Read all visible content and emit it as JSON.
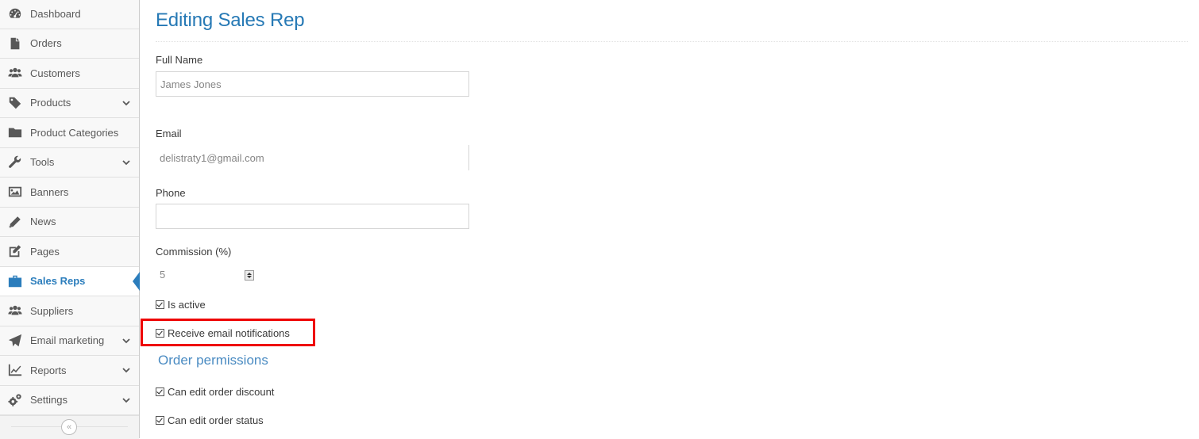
{
  "sidebar": {
    "items": [
      {
        "name": "dashboard",
        "label": "Dashboard",
        "icon": "dashboard-icon",
        "chevron": false,
        "active": false
      },
      {
        "name": "orders",
        "label": "Orders",
        "icon": "file-icon",
        "chevron": false,
        "active": false
      },
      {
        "name": "customers",
        "label": "Customers",
        "icon": "users-icon",
        "chevron": false,
        "active": false
      },
      {
        "name": "products",
        "label": "Products",
        "icon": "tag-icon",
        "chevron": true,
        "active": false
      },
      {
        "name": "product-categories",
        "label": "Product Categories",
        "icon": "folder-icon",
        "chevron": false,
        "active": false
      },
      {
        "name": "tools",
        "label": "Tools",
        "icon": "wrench-icon",
        "chevron": true,
        "active": false
      },
      {
        "name": "banners",
        "label": "Banners",
        "icon": "image-icon",
        "chevron": false,
        "active": false
      },
      {
        "name": "news",
        "label": "News",
        "icon": "pencil-icon",
        "chevron": false,
        "active": false
      },
      {
        "name": "pages",
        "label": "Pages",
        "icon": "edit-icon",
        "chevron": false,
        "active": false
      },
      {
        "name": "sales-reps",
        "label": "Sales Reps",
        "icon": "briefcase-icon",
        "chevron": false,
        "active": true
      },
      {
        "name": "suppliers",
        "label": "Suppliers",
        "icon": "users-icon",
        "chevron": false,
        "active": false
      },
      {
        "name": "email-marketing",
        "label": "Email marketing",
        "icon": "paper-plane-icon",
        "chevron": true,
        "active": false
      },
      {
        "name": "reports",
        "label": "Reports",
        "icon": "line-chart-icon",
        "chevron": true,
        "active": false
      },
      {
        "name": "settings",
        "label": "Settings",
        "icon": "gears-icon",
        "chevron": true,
        "active": false
      }
    ],
    "collapse_glyph": "«",
    "active_color": "#2b7dbc"
  },
  "page": {
    "title": "Editing Sales Rep"
  },
  "form": {
    "full_name": {
      "label": "Full Name",
      "value": "James Jones"
    },
    "email": {
      "label": "Email",
      "value": "delistraty1@gmail.com"
    },
    "phone": {
      "label": "Phone",
      "value": ""
    },
    "commission": {
      "label": "Commission (%)",
      "value": "5"
    },
    "is_active": {
      "label": "Is active",
      "checked": true
    },
    "receive_notifications": {
      "label": "Receive email notifications",
      "checked": true
    }
  },
  "order_permissions": {
    "title": "Order permissions",
    "items": [
      {
        "label": "Can edit order discount",
        "checked": true
      },
      {
        "label": "Can edit order status",
        "checked": true
      }
    ]
  },
  "highlight_color": "#ee0000"
}
